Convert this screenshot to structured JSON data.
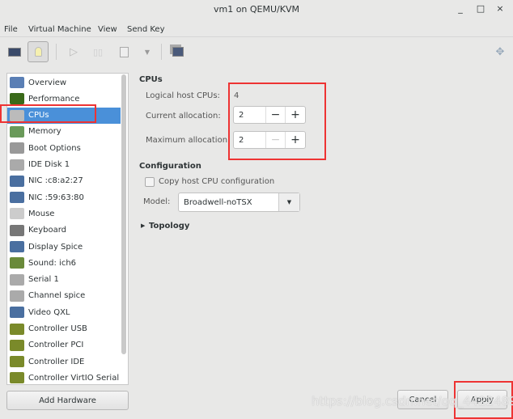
{
  "window": {
    "title": "vm1 on QEMU/KVM",
    "minimize": "_",
    "maximize": "□",
    "close": "×"
  },
  "menu": [
    "File",
    "Virtual Machine",
    "View",
    "Send Key"
  ],
  "toolbar": {
    "icons": [
      "console-monitor-icon",
      "details-lightbulb-icon",
      "run-icon",
      "pause-icon",
      "shutdown-icon",
      "shutdown-dropdown-icon",
      "snapshots-icon",
      "fullscreen-icon"
    ]
  },
  "sidebar": {
    "items": [
      {
        "label": "Overview",
        "color": "#5a7fb5"
      },
      {
        "label": "Performance",
        "color": "#3a6a1a"
      },
      {
        "label": "CPUs",
        "color": "#bbbbbb"
      },
      {
        "label": "Memory",
        "color": "#6a9a5a"
      },
      {
        "label": "Boot Options",
        "color": "#999999"
      },
      {
        "label": "IDE Disk 1",
        "color": "#aaaaaa"
      },
      {
        "label": "NIC :c8:a2:27",
        "color": "#4a6fa0"
      },
      {
        "label": "NIC :59:63:80",
        "color": "#4a6fa0"
      },
      {
        "label": "Mouse",
        "color": "#cccccc"
      },
      {
        "label": "Keyboard",
        "color": "#777777"
      },
      {
        "label": "Display Spice",
        "color": "#4a6fa0"
      },
      {
        "label": "Sound: ich6",
        "color": "#6a8a3a"
      },
      {
        "label": "Serial 1",
        "color": "#aaaaaa"
      },
      {
        "label": "Channel spice",
        "color": "#aaaaaa"
      },
      {
        "label": "Video QXL",
        "color": "#4a6fa0"
      },
      {
        "label": "Controller USB",
        "color": "#7a8a2a"
      },
      {
        "label": "Controller PCI",
        "color": "#7a8a2a"
      },
      {
        "label": "Controller IDE",
        "color": "#7a8a2a"
      },
      {
        "label": "Controller VirtIO Serial",
        "color": "#7a8a2a"
      }
    ],
    "selected": "CPUs",
    "add_hardware": "Add Hardware"
  },
  "cpus": {
    "header": "CPUs",
    "logical_label": "Logical host CPUs:",
    "logical_value": "4",
    "current_label": "Current allocation:",
    "current_value": "2",
    "max_label": "Maximum allocation:",
    "max_value": "2",
    "minus": "−",
    "plus": "+"
  },
  "configuration": {
    "header": "Configuration",
    "copy_host": "Copy host CPU configuration",
    "copy_host_checked": false,
    "model_label": "Model:",
    "model_value": "Broadwell-noTSX"
  },
  "topology": {
    "label": "Topology",
    "expanded": false
  },
  "buttons": {
    "cancel": "Cancel",
    "apply": "Apply"
  },
  "watermark": "https://blog.csdn.net/qq_44224894"
}
